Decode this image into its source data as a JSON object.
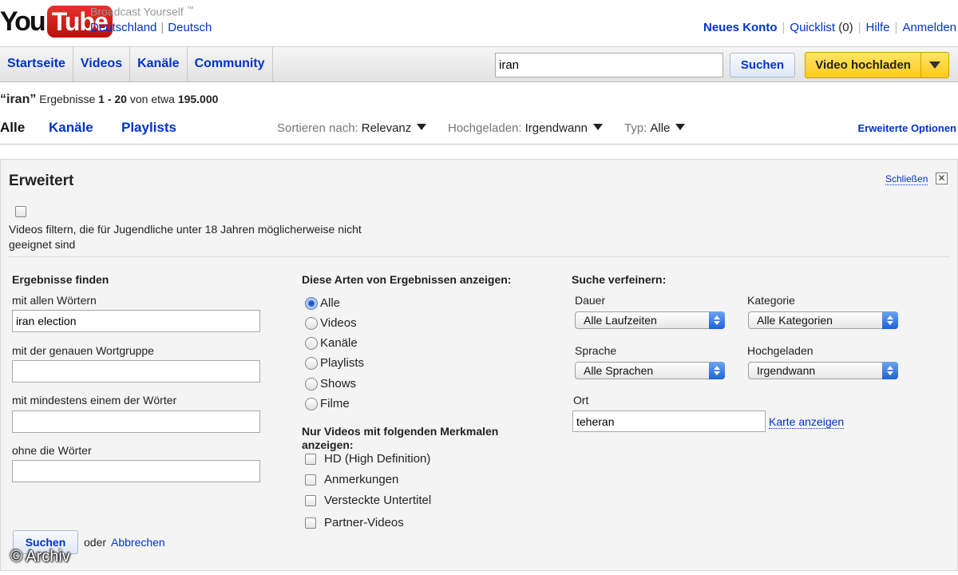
{
  "header": {
    "logo_you": "You",
    "logo_tube": "Tube",
    "tagline": "Broadcast Yourself",
    "tagline_tm": "™",
    "country": "Deutschland",
    "language": "Deutsch",
    "links": {
      "new_account": "Neues Konto",
      "quicklist": "Quicklist",
      "quicklist_count": "(0)",
      "help": "Hilfe",
      "login": "Anmelden"
    }
  },
  "nav": {
    "tabs": [
      "Startseite",
      "Videos",
      "Kanäle",
      "Community"
    ],
    "search_value": "iran",
    "search_button": "Suchen",
    "upload_button": "Video hochladen"
  },
  "results": {
    "query": "“iran”",
    "prefix": "Ergebnisse",
    "range": "1 - 20",
    "mid": "von etwa",
    "total": "195.000"
  },
  "filters": {
    "tabs": [
      "Alle",
      "Kanäle",
      "Playlists"
    ],
    "sort_label": "Sortieren nach:",
    "sort_value": "Relevanz",
    "uploaded_label": "Hochgeladen:",
    "uploaded_value": "Irgendwann",
    "type_label": "Typ:",
    "type_value": "Alle",
    "advanced_link": "Erweiterte Optionen"
  },
  "advanced": {
    "title": "Erweitert",
    "close": "Schließen",
    "close_symbol": "✕",
    "filter_text": "Videos filtern, die für Jugendliche unter 18 Jahren möglicherweise nicht geeignet sind",
    "find": {
      "heading": "Ergebnisse finden",
      "all_words_label": "mit allen Wörtern",
      "all_words_value": "iran election",
      "exact_label": "mit der genauen Wortgruppe",
      "exact_value": "",
      "any_label": "mit mindestens einem der Wörter",
      "any_value": "",
      "without_label": "ohne die Wörter",
      "without_value": ""
    },
    "types": {
      "heading": "Diese Arten von Ergebnissen anzeigen:",
      "options": [
        "Alle",
        "Videos",
        "Kanäle",
        "Playlists",
        "Shows",
        "Filme"
      ],
      "selected": "Alle"
    },
    "features": {
      "heading": "Nur Videos mit folgenden Merkmalen anzeigen:",
      "options": [
        "HD (High Definition)",
        "Anmerkungen",
        "Versteckte Untertitel",
        "Partner-Videos"
      ]
    },
    "refine": {
      "heading": "Suche verfeinern:",
      "duration_label": "Dauer",
      "duration_value": "Alle Laufzeiten",
      "category_label": "Kategorie",
      "category_value": "Alle Kategorien",
      "language_label": "Sprache",
      "language_value": "Alle Sprachen",
      "uploaded_label": "Hochgeladen",
      "uploaded_value": "Irgendwann",
      "location_label": "Ort",
      "location_value": "teheran",
      "map_link": "Karte anzeigen"
    },
    "search_button": "Suchen",
    "or_text": "oder",
    "cancel_link": "Abbrechen"
  },
  "watermark": "© Archiv"
}
